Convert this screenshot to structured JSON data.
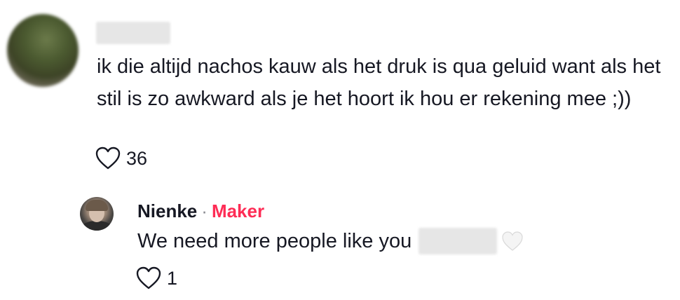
{
  "comment": {
    "text": "ik die altijd nachos kauw als het druk is qua geluid want als het stil is zo awkward als je het hoort ik hou er rekening mee ;))",
    "likes": "36"
  },
  "reply": {
    "author": "Nienke",
    "separator": "·",
    "badge": "Maker",
    "text": "We need more people like you",
    "emoji": "white-heart",
    "likes": "1"
  },
  "colors": {
    "badge": "#fe2c55",
    "text": "#161823",
    "secondary": "#8a8b91"
  }
}
